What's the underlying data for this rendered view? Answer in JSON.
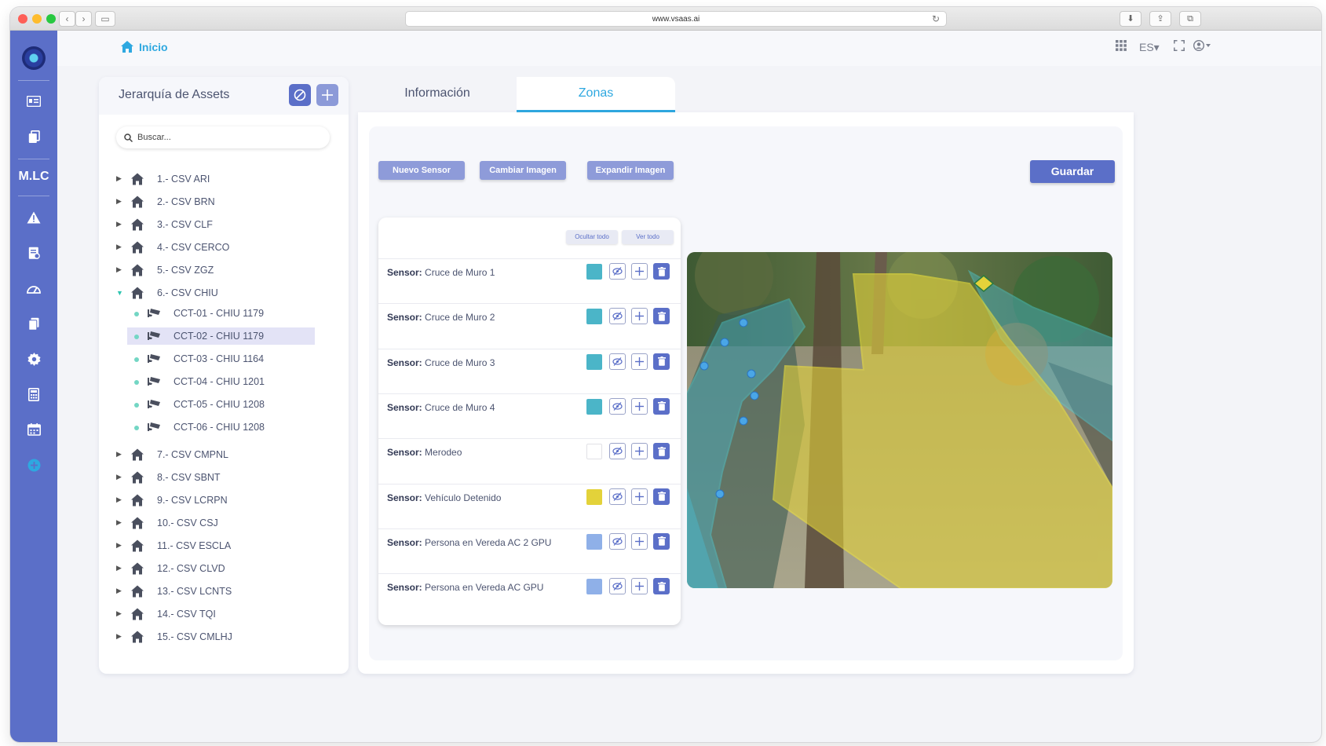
{
  "browser": {
    "url": "www.vsaas.ai"
  },
  "sidebar": {
    "brand_text": "M.LC"
  },
  "topbar": {
    "home_label": "Inicio",
    "language": "ES▾"
  },
  "assets": {
    "title": "Jerarquía de Assets",
    "search_placeholder": "Buscar...",
    "items_before": [
      "1.- CSV ARI",
      "2.- CSV BRN",
      "3.- CSV CLF",
      "4.- CSV CERCO",
      "5.- CSV ZGZ"
    ],
    "expanded": {
      "label": "6.- CSV CHIU",
      "children": [
        "CCT-01 - CHIU 1179",
        "CCT-02 - CHIU 1179",
        "CCT-03 - CHIU 1164",
        "CCT-04 - CHIU 1201",
        "CCT-05 - CHIU 1208",
        "CCT-06 - CHIU 1208"
      ],
      "selected_child": "CCT-02 - CHIU 1179"
    },
    "items_after": [
      "7.- CSV CMPNL",
      "8.- CSV SBNT",
      "9.- CSV LCRPN",
      "10.- CSV CSJ",
      "11.- CSV ESCLA",
      "12.- CSV CLVD",
      "13.- CSV LCNTS",
      "14.- CSV TQI",
      "15.- CSV CMLHJ"
    ]
  },
  "tabs": {
    "info": "Información",
    "zonas": "Zonas",
    "active": "Zonas"
  },
  "toolbar": {
    "new_sensor": "Nuevo Sensor",
    "change_image": "Cambiar Imagen",
    "expand_image": "Expandir Imagen",
    "save": "Guardar"
  },
  "sensors": {
    "prefix": "Sensor:",
    "hide_all": "Ocultar todo",
    "show_all": "Ver todo",
    "list": [
      {
        "name": "Cruce de Muro 1",
        "color": "#4bb5c8"
      },
      {
        "name": "Cruce de Muro 2",
        "color": "#4bb5c8"
      },
      {
        "name": "Cruce de Muro 3",
        "color": "#4bb5c8"
      },
      {
        "name": "Cruce de Muro 4",
        "color": "#4bb5c8"
      },
      {
        "name": "Merodeo",
        "color": "#ffffff"
      },
      {
        "name": "Vehículo Detenido",
        "color": "#e3d23a"
      },
      {
        "name": "Persona en Vereda AC 2 GPU",
        "color": "#8fb0e8"
      },
      {
        "name": "Persona en Vereda AC GPU",
        "color": "#8fb0e8"
      }
    ]
  },
  "colors": {
    "primary": "#5b6fc8",
    "accent": "#2ea8e0",
    "zone_cyan": "#4bb5c8",
    "zone_yellow": "#e3d23a"
  }
}
